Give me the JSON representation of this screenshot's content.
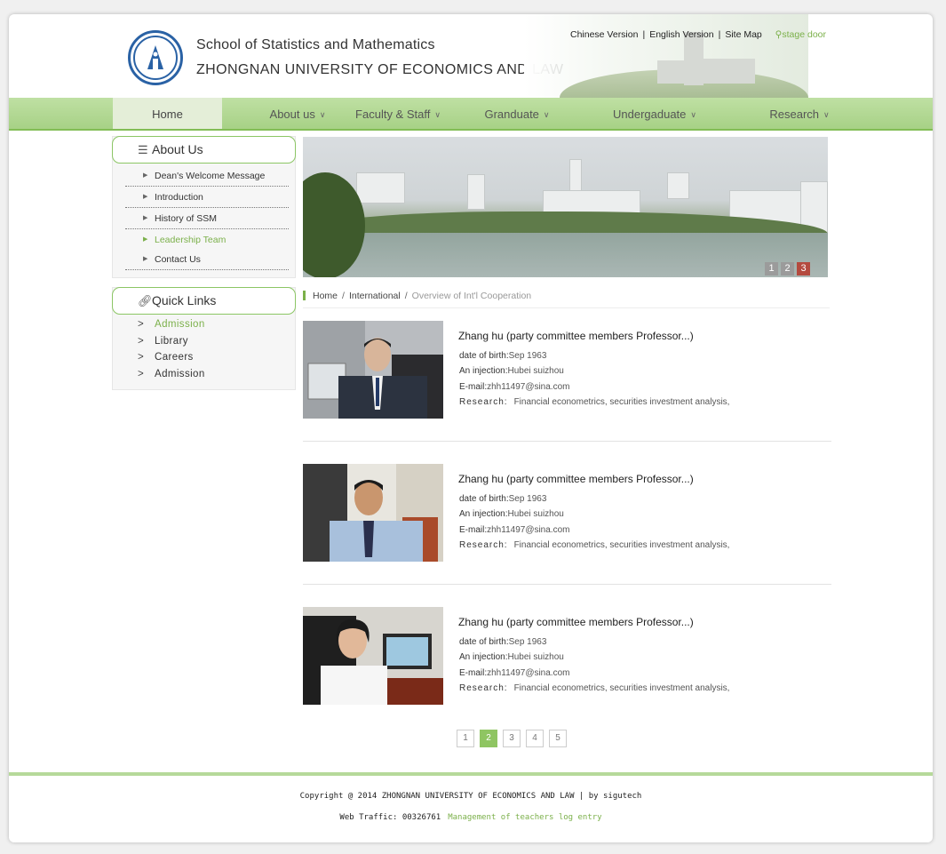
{
  "header": {
    "school_name": "School of Statistics and Mathematics",
    "university_name": "ZHONGNAN UNIVERSITY OF ECONOMICS AND LAW",
    "links": {
      "chinese": "Chinese Version",
      "english": "English Version",
      "sitemap": "Site Map",
      "stage": "stage door"
    }
  },
  "nav": {
    "items": [
      "Home",
      "About us",
      "Faculty & Staff",
      "Granduate",
      "Undergaduate",
      "Research"
    ],
    "active": "Home"
  },
  "sidebar": {
    "about": {
      "title": "About Us",
      "items": [
        "Dean's Welcome Message",
        "Introduction",
        "History of SSM",
        "Leadership Team",
        "Contact Us"
      ],
      "active": "Leadership Team"
    },
    "quick_links": {
      "title": "Quick Links",
      "items": [
        "Admission",
        "Library",
        "Careers",
        "Admission"
      ]
    }
  },
  "banner": {
    "slides": [
      "1",
      "2",
      "3"
    ],
    "active_slide": "3"
  },
  "breadcrumb": {
    "items": [
      "Home",
      "International",
      "Overview of Int'l Cooperation"
    ],
    "separator": "/"
  },
  "members": [
    {
      "name": "Zhang hu (party committee members Professor...)",
      "birth_label": "date of birth:",
      "birth": "Sep 1963",
      "injection_label": "An injection:",
      "injection": "Hubei suizhou",
      "email_label": "E-mail:",
      "email": "zhh11497@sina.com",
      "research_label": "Research:",
      "research": "Financial econometrics, securities investment analysis,"
    },
    {
      "name": "Zhang hu (party committee members Professor...)",
      "birth_label": "date of birth:",
      "birth": "Sep 1963",
      "injection_label": "An injection:",
      "injection": "Hubei suizhou",
      "email_label": "E-mail:",
      "email": "zhh11497@sina.com",
      "research_label": "Research:",
      "research": "Financial econometrics, securities investment analysis,"
    },
    {
      "name": "Zhang hu (party committee members Professor...)",
      "birth_label": "date of birth:",
      "birth": "Sep 1963",
      "injection_label": "An injection:",
      "injection": "Hubei suizhou",
      "email_label": "E-mail:",
      "email": "zhh11497@sina.com",
      "research_label": "Research:",
      "research": "Financial econometrics, securities investment analysis,"
    }
  ],
  "pagination": {
    "pages": [
      "1",
      "2",
      "3",
      "4",
      "5"
    ],
    "active": "2"
  },
  "footer": {
    "copyright": "Copyright @ 2014 ZHONGNAN UNIVERSITY OF ECONOMICS AND LAW | by sigutech",
    "traffic_label": "Web Traffic: 00326761",
    "manage_link": "Management of teachers log entry"
  },
  "colors": {
    "accent_green": "#7bb04a",
    "nav_green": "#a7d186",
    "active_slide": "#b44a3f"
  }
}
